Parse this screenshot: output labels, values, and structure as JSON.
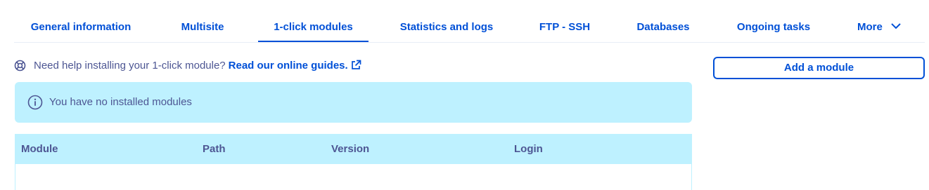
{
  "tabs": [
    {
      "label": "General information"
    },
    {
      "label": "Multisite"
    },
    {
      "label": "1-click modules",
      "active": true
    },
    {
      "label": "Statistics and logs"
    },
    {
      "label": "FTP - SSH"
    },
    {
      "label": "Databases"
    },
    {
      "label": "Ongoing tasks"
    },
    {
      "label": "More"
    }
  ],
  "help": {
    "text": "Need help installing your 1-click module?",
    "link_label": "Read our online guides."
  },
  "add_button_label": "Add a module",
  "info_message": "You have no installed modules",
  "table": {
    "columns": [
      "Module",
      "Path",
      "Version",
      "Login"
    ]
  },
  "colors": {
    "primary": "#0050d7",
    "text": "#4d5693",
    "info_background": "#bef1ff"
  }
}
